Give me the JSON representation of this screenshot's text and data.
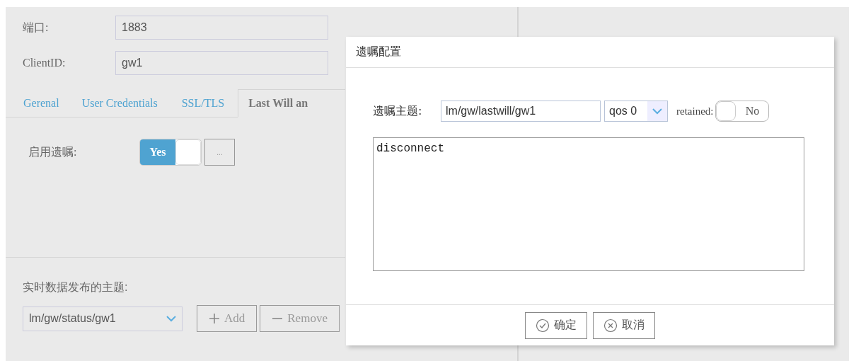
{
  "form": {
    "fields": [
      {
        "label": "端口:",
        "value": "1883"
      },
      {
        "label": "ClientID:",
        "value": "gw1"
      }
    ]
  },
  "tabs": [
    {
      "label": "Gerenal",
      "selected": false
    },
    {
      "label": "User Credentials",
      "selected": false
    },
    {
      "label": "SSL/TLS",
      "selected": false
    },
    {
      "label": "Last Will an",
      "selected": true
    }
  ],
  "last_will": {
    "label": "启用遗嘱:",
    "on": true,
    "toggle_text": "Yes",
    "more_button": "..."
  },
  "publish_topics": {
    "label": "实时数据发布的主题:",
    "value": "lm/gw/status/gw1",
    "buttons": [
      {
        "kind": "add",
        "label": "Add"
      },
      {
        "kind": "remove",
        "label": "Remove"
      }
    ]
  },
  "dialog": {
    "title": "遗嘱配置",
    "topic_label": "遗嘱主题:",
    "topic_value": "lm/gw/lastwill/gw1",
    "qos": "qos 0",
    "retained_label": "retained:",
    "retained": {
      "on": false,
      "text": "No"
    },
    "message": "disconnect",
    "buttons": [
      {
        "kind": "ok",
        "label": "确定"
      },
      {
        "kind": "cancel",
        "label": "取消"
      }
    ]
  }
}
